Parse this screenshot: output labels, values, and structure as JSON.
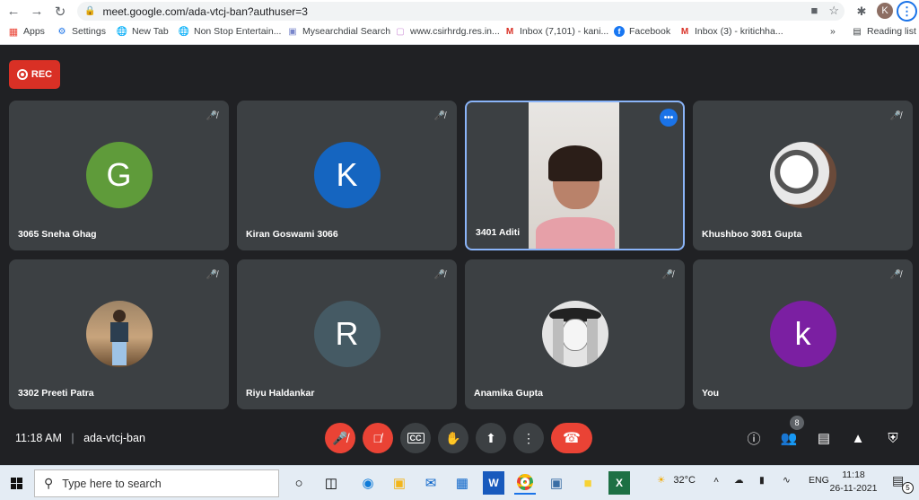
{
  "browser": {
    "url": "meet.google.com/ada-vtcj-ban?authuser=3",
    "profile_initial": "K"
  },
  "bookmarks": [
    {
      "label": "Apps",
      "icon": "apps-grid-icon"
    },
    {
      "label": "Settings",
      "icon": "gear-icon"
    },
    {
      "label": "New Tab",
      "icon": "globe-icon"
    },
    {
      "label": "Non Stop Entertain...",
      "icon": "globe-icon"
    },
    {
      "label": "Mysearchdial Search",
      "icon": "page-icon"
    },
    {
      "label": "www.csirhrdg.res.in...",
      "icon": "page-icon"
    },
    {
      "label": "Inbox (7,101) - kani...",
      "icon": "gmail-icon"
    },
    {
      "label": "Facebook",
      "icon": "facebook-icon"
    },
    {
      "label": "Inbox (3) - kritichha...",
      "icon": "gmail-icon"
    }
  ],
  "bookmarks_overflow": "»",
  "reading_list": "Reading list",
  "meet": {
    "rec_label": "REC",
    "tiles": [
      {
        "name": "3065 Sneha Ghag",
        "initial": "G",
        "color": "#5f9b3a",
        "type": "initial"
      },
      {
        "name": "Kiran Goswami 3066",
        "initial": "K",
        "color": "#1565c0",
        "type": "initial"
      },
      {
        "name": "3401 Aditi",
        "type": "video"
      },
      {
        "name": "Khushboo 3081 Gupta",
        "type": "photo"
      },
      {
        "name": "3302 Preeti Patra",
        "type": "photo"
      },
      {
        "name": "Riyu Haldankar",
        "initial": "R",
        "color": "#455a64",
        "type": "initial"
      },
      {
        "name": "Anamika Gupta",
        "type": "photo"
      },
      {
        "name": "You",
        "initial": "k",
        "color": "#7b1fa2",
        "type": "initial"
      }
    ],
    "time": "11:18 AM",
    "meeting_code": "ada-vtcj-ban",
    "people_count": "8"
  },
  "taskbar": {
    "search_placeholder": "Type here to search",
    "weather": "32°C",
    "language": "ENG",
    "time": "11:18",
    "date": "26-11-2021",
    "notification_count": "5"
  }
}
